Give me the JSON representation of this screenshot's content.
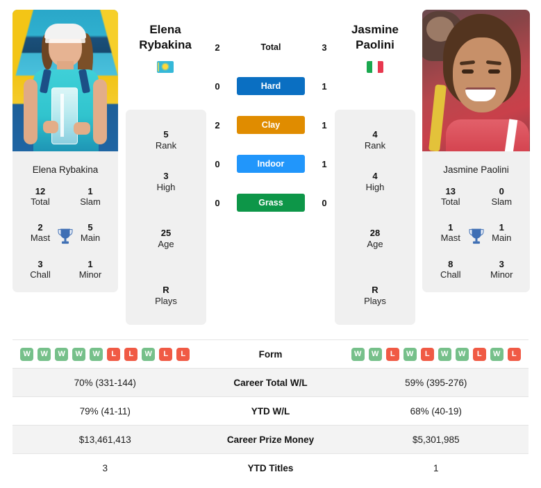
{
  "players": {
    "left": {
      "first_name": "Elena",
      "last_name": "Rybakina",
      "full_name": "Elena Rybakina",
      "country_code": "KZ",
      "flag_name": "kazakhstan-flag",
      "photo_name": "rybakina-photo",
      "titles": [
        {
          "num": "12",
          "label": "Total"
        },
        {
          "num": "1",
          "label": "Slam"
        },
        {
          "num": "2",
          "label": "Mast"
        },
        {
          "num": "5",
          "label": "Main"
        },
        {
          "num": "3",
          "label": "Chall"
        },
        {
          "num": "1",
          "label": "Minor"
        }
      ],
      "ranking": [
        {
          "num": "5",
          "label": "Rank"
        },
        {
          "num": "3",
          "label": "High"
        },
        {
          "num": "25",
          "label": "Age"
        },
        {
          "num": "R",
          "label": "Plays"
        }
      ],
      "form": [
        "W",
        "W",
        "W",
        "W",
        "W",
        "L",
        "L",
        "W",
        "L",
        "L"
      ],
      "career_total_wl": "70% (331-144)",
      "ytd_wl": "79% (41-11)",
      "career_prize_money": "$13,461,413",
      "ytd_titles": "3"
    },
    "right": {
      "first_name": "Jasmine",
      "last_name": "Paolini",
      "full_name": "Jasmine Paolini",
      "country_code": "IT",
      "flag_name": "italy-flag",
      "photo_name": "paolini-photo",
      "titles": [
        {
          "num": "13",
          "label": "Total"
        },
        {
          "num": "0",
          "label": "Slam"
        },
        {
          "num": "1",
          "label": "Mast"
        },
        {
          "num": "1",
          "label": "Main"
        },
        {
          "num": "8",
          "label": "Chall"
        },
        {
          "num": "3",
          "label": "Minor"
        }
      ],
      "ranking": [
        {
          "num": "4",
          "label": "Rank"
        },
        {
          "num": "4",
          "label": "High"
        },
        {
          "num": "28",
          "label": "Age"
        },
        {
          "num": "R",
          "label": "Plays"
        }
      ],
      "form": [
        "W",
        "W",
        "L",
        "W",
        "L",
        "W",
        "W",
        "L",
        "W",
        "L"
      ],
      "career_total_wl": "59% (395-276)",
      "ytd_wl": "68% (40-19)",
      "career_prize_money": "$5,301,985",
      "ytd_titles": "1"
    }
  },
  "head_to_head": [
    {
      "label": "Total",
      "left": "2",
      "right": "3",
      "color": "transparent",
      "text_color": "#111111"
    },
    {
      "label": "Hard",
      "left": "0",
      "right": "1",
      "color": "#0a6fc2",
      "text_color": "#ffffff"
    },
    {
      "label": "Clay",
      "left": "2",
      "right": "1",
      "color": "#e08c00",
      "text_color": "#ffffff"
    },
    {
      "label": "Indoor",
      "left": "0",
      "right": "1",
      "color": "#2196fb",
      "text_color": "#ffffff"
    },
    {
      "label": "Grass",
      "left": "0",
      "right": "0",
      "color": "#0d9648",
      "text_color": "#ffffff"
    }
  ],
  "table_labels": {
    "form": "Form",
    "career_total_wl": "Career Total W/L",
    "ytd_wl": "YTD W/L",
    "career_prize_money": "Career Prize Money",
    "ytd_titles": "YTD Titles"
  },
  "colors": {
    "win_badge": "#76c08a",
    "loss_badge": "#f05a45",
    "card_bg": "#f0f0f0",
    "row_shade": "#f3f3f3",
    "trophy": "#3f6fb4"
  },
  "icons": {
    "trophy": "trophy-icon"
  }
}
